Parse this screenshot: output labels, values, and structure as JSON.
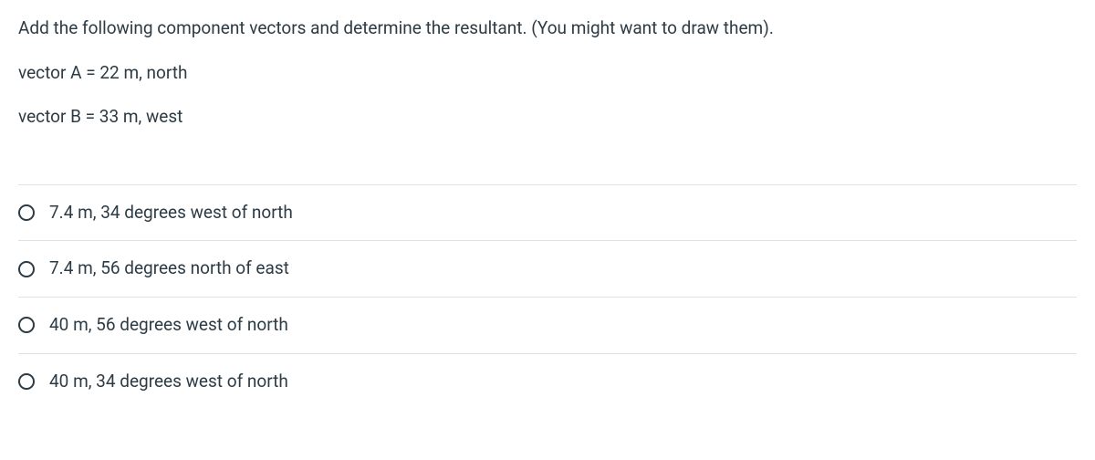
{
  "question": {
    "prompt": "Add the following component vectors and determine the resultant. (You might want to draw them).",
    "vectorA": "vector A = 22 m, north",
    "vectorB": "vector B = 33 m, west"
  },
  "options": [
    {
      "label": "7.4 m, 34 degrees west of north"
    },
    {
      "label": "7.4 m, 56 degrees north of east"
    },
    {
      "label": "40 m, 56 degrees west of north"
    },
    {
      "label": "40 m, 34 degrees west of north"
    }
  ]
}
